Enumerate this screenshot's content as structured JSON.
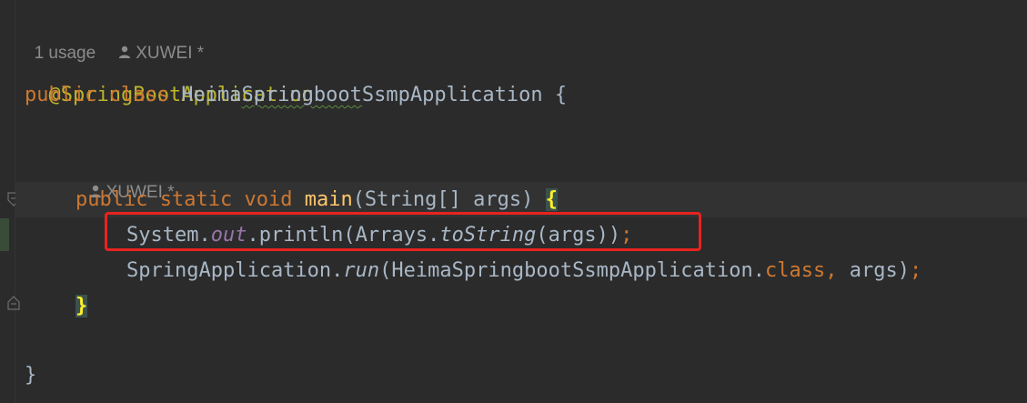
{
  "code_lens_class": {
    "usages": "1 usage",
    "author": "XUWEI *",
    "user_icon": "person-icon"
  },
  "code_lens_method": {
    "author": "XUWEI *",
    "user_icon": "person-icon"
  },
  "code": {
    "annotation": "@SpringBootApplication",
    "class_line": {
      "public": "public",
      "class": "class",
      "name_pre": "Heima",
      "name_typo": "Springboot",
      "name_post": "SsmpApplication",
      "brace": " {"
    },
    "main_line": {
      "public": "public",
      "static": "static",
      "void": "void",
      "method": "main",
      "params": "(String[] args)",
      "brace": "{"
    },
    "println_line": {
      "system": "System.",
      "out": "out",
      "println": ".println(Arrays.",
      "to_string": "toString",
      "args": "(args))",
      "semi": ";"
    },
    "run_line": {
      "spring_app": "SpringApplication.",
      "run": "run",
      "args_open": "(HeimaSpringbootSsmpApplication.",
      "class_kw": "class",
      "comma": ",",
      "args_close": " args)",
      "semi": ";"
    },
    "method_close": "}",
    "class_close": "}"
  },
  "colors": {
    "background": "#2b2b2b",
    "keyword": "#cc7832",
    "annotation": "#bbb529",
    "method_decl": "#ffc66d",
    "static_field": "#9876aa",
    "default_text": "#a9b7c6",
    "highlight_box": "#e8231f"
  }
}
